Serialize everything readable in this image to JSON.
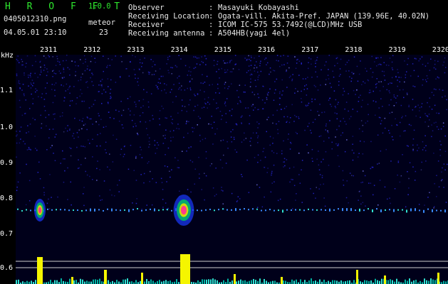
{
  "header": {
    "app_title": "H R O F F T",
    "version": "1.0.0",
    "filename": "0405012310.png",
    "datetime": "04.05.01 23:10",
    "meteor_label": "meteor",
    "meteor_count": "23",
    "info": [
      {
        "label": "Observer",
        "sep": ":",
        "value": "Masayuki Kobayashi"
      },
      {
        "label": "Receiving Location",
        "sep": ":",
        "value": "Ogata-vill. Akita-Pref. JAPAN (139.96E, 40.02N)"
      },
      {
        "label": "Receiver",
        "sep": ":",
        "value": "ICOM IC-575 53.7492(@LCD)MHz USB"
      },
      {
        "label": "Receiving antenna",
        "sep": ":",
        "value": "A504HB(yagi 4el)"
      }
    ]
  },
  "spectrogram": {
    "y_unit": "kHz",
    "y_ticks": [
      "1.1",
      "1.0",
      "0.9",
      "0.8",
      "0.7",
      "0.6"
    ],
    "x_ticks": [
      "2311",
      "2312",
      "2313",
      "2314",
      "2315",
      "2316",
      "2317",
      "2318",
      "2319",
      "2320"
    ],
    "colors": {
      "background": "#00001a",
      "noise": "#2a2ae6",
      "echo_hot": "#ff3a8a",
      "echo_cool": "#2fe0d0",
      "bar": "#f5f500",
      "axis": "#ffffff"
    }
  }
}
